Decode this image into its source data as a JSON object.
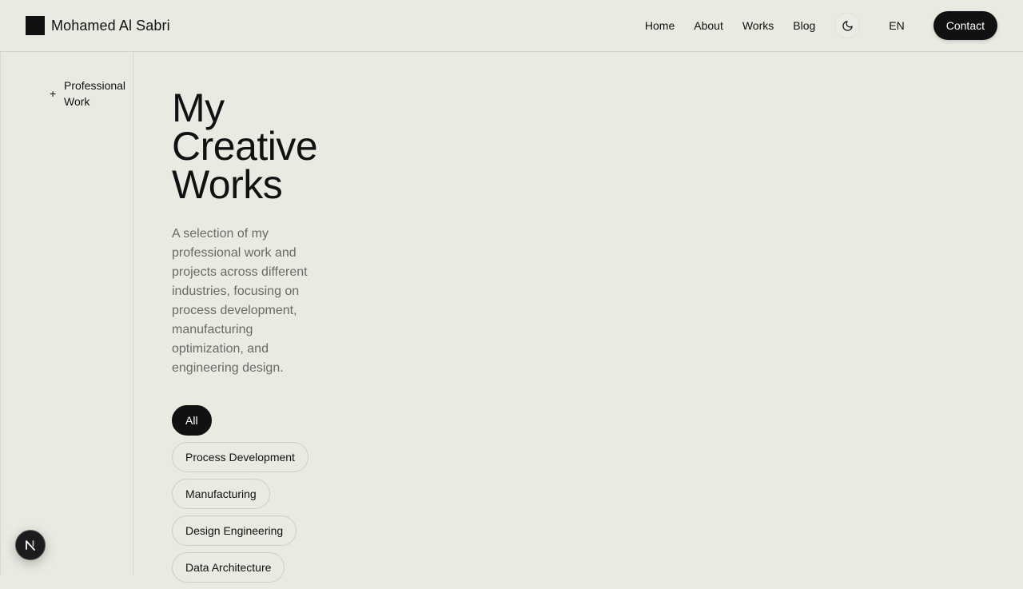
{
  "brand": {
    "name": "Mohamed Al Sabri",
    "logo_icon": "square-logo-icon"
  },
  "nav": {
    "links": [
      "Home",
      "About",
      "Works",
      "Blog"
    ],
    "theme_toggle_icon": "moon-icon",
    "language": "EN",
    "contact_label": "Contact"
  },
  "sidebar": {
    "items": [
      {
        "icon": "plus-icon",
        "label": "Professional Work"
      }
    ]
  },
  "main": {
    "title_lines": [
      "My",
      "Creative",
      "Works"
    ],
    "description": "A selection of my professional work and projects across different industries, focusing on process development, manufacturing optimization, and engineering design.",
    "filters": [
      {
        "label": "All",
        "active": true
      },
      {
        "label": "Process Development",
        "active": false
      },
      {
        "label": "Manufacturing",
        "active": false
      },
      {
        "label": "Design Engineering",
        "active": false
      },
      {
        "label": "Data Architecture",
        "active": false
      }
    ]
  },
  "dev_badge": {
    "letter": "N",
    "icon": "nextjs-icon"
  },
  "colors": {
    "background": "#eae9e2",
    "text": "#111111",
    "muted_text": "#6a6a66",
    "border": "#d3d2cb",
    "accent": "#111111"
  }
}
